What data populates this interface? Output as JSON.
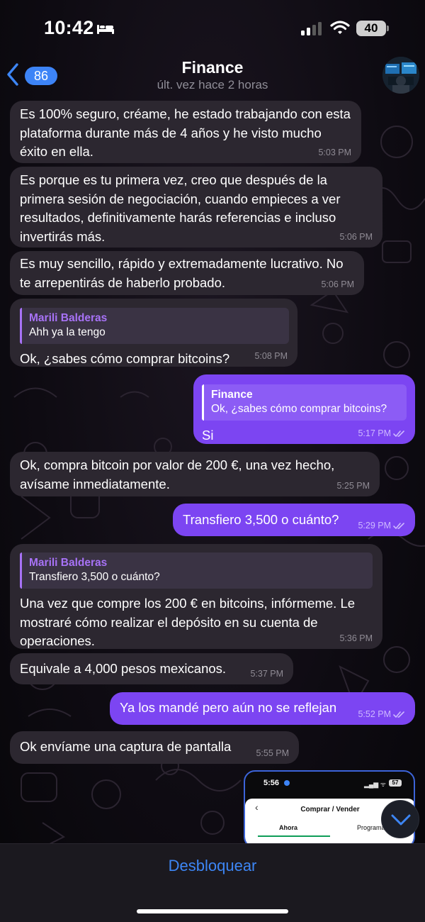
{
  "status_bar": {
    "time": "10:42",
    "battery": "40"
  },
  "header": {
    "back_count": "86",
    "title": "Finance",
    "subtitle": "últ. vez hace 2 horas"
  },
  "messages": [
    {
      "direction": "in",
      "text": "Es 100% seguro, créame, he estado trabajando con esta plataforma durante más de 4 años y he visto mucho éxito en ella.",
      "time": "5:03 PM"
    },
    {
      "direction": "in",
      "text": "Es porque es tu primera vez, creo que después de la primera sesión de negociación, cuando empieces a ver resultados, definitivamente harás referencias e incluso invertirás más.",
      "time": "5:06 PM"
    },
    {
      "direction": "in",
      "text": "Es muy sencillo, rápido y extremadamente lucrativo. No te arrepentirás de haberlo probado.",
      "time": "5:06 PM"
    },
    {
      "direction": "in",
      "reply_name": "Marili Balderas",
      "reply_text": "Ahh ya la tengo",
      "text": "Ok, ¿sabes cómo comprar bitcoins?",
      "time": "5:08 PM"
    },
    {
      "direction": "out",
      "reply_name": "Finance",
      "reply_text": "Ok, ¿sabes cómo comprar bitcoins?",
      "text": "Si",
      "time": "5:17 PM",
      "read": true
    },
    {
      "direction": "in",
      "text": "Ok, compra bitcoin por valor de 200 €, una vez hecho, avísame inmediatamente.",
      "time": "5:25 PM"
    },
    {
      "direction": "out",
      "text": "Transfiero 3,500 o cuánto?",
      "time": "5:29 PM",
      "read": true
    },
    {
      "direction": "in",
      "reply_name": "Marili Balderas",
      "reply_text": "Transfiero 3,500 o cuánto?",
      "text": "Una vez que compre los 200 € en bitcoins, infórmeme. Le mostraré cómo realizar el depósito en su cuenta de operaciones.",
      "time": "5:36 PM"
    },
    {
      "direction": "in",
      "text": "Equivale a 4,000 pesos mexicanos.",
      "time": "5:37 PM"
    },
    {
      "direction": "out",
      "text": "Ya los mandé pero aún no se reflejan",
      "time": "5:52 PM",
      "read": true
    },
    {
      "direction": "in",
      "text": "Ok envíame una captura de pantalla",
      "time": "5:55 PM"
    }
  ],
  "image_preview": {
    "time": "5:56",
    "battery": "57",
    "title": "Comprar / Vender",
    "tab_active": "Ahora",
    "tab_other": "Programa"
  },
  "bottom_bar": {
    "action_label": "Desbloquear"
  },
  "colors": {
    "incoming_bubble": "#2c2730",
    "outgoing_bubble": "#7c45f2",
    "accent": "#3d86f5"
  }
}
